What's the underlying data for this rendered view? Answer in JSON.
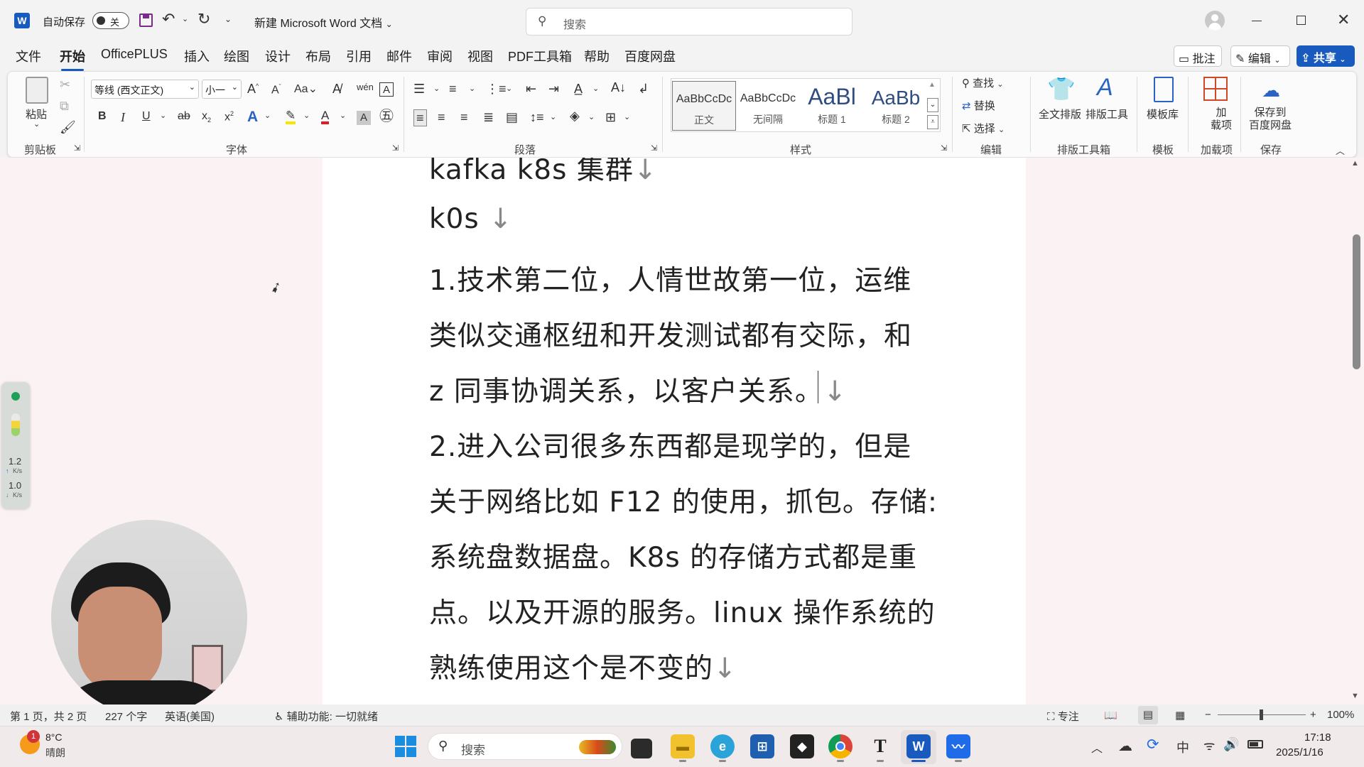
{
  "app": {
    "logo_letter": "W",
    "autosave_label": "自动保存",
    "autosave_state": "关",
    "doc_title": "新建 Microsoft Word 文档",
    "search_placeholder": "搜索"
  },
  "menu": {
    "items": [
      "文件",
      "开始",
      "OfficePLUS",
      "插入",
      "绘图",
      "设计",
      "布局",
      "引用",
      "邮件",
      "审阅",
      "视图",
      "PDF工具箱",
      "帮助",
      "百度网盘"
    ],
    "active": "开始",
    "comment_label": "批注",
    "edit_label": "编辑",
    "share_label": "共享"
  },
  "ribbon": {
    "paste_label": "粘贴",
    "font_name": "等线 (西文正文)",
    "font_size": "小一",
    "styles": [
      {
        "preview": "AaBbCcDc",
        "name": "正文",
        "active": true
      },
      {
        "preview": "AaBbCcDc",
        "name": "无间隔",
        "active": false
      },
      {
        "preview": "AaBl",
        "name": "标题 1",
        "active": false
      },
      {
        "preview": "AaBb",
        "name": "标题 2",
        "active": false
      }
    ],
    "find_label": "查找",
    "replace_label": "替换",
    "select_label": "选择",
    "fulltext_layout_label": "全文排版",
    "layout_tool_label": "排版工具",
    "template_lib_label": "模板库",
    "addin_label_1": "加",
    "addin_label_2": "载项",
    "save_baidu_1": "保存到",
    "save_baidu_2": "百度网盘",
    "groups": {
      "clipboard": "剪贴板",
      "font": "字体",
      "paragraph": "段落",
      "styles": "样式",
      "editing": "编辑",
      "layout_toolbox": "排版工具箱",
      "template": "模板",
      "addins": "加载项",
      "save": "保存"
    }
  },
  "document": {
    "lines": [
      {
        "text": "kafka k8s 集群",
        "mark": "↓"
      },
      {
        "text": "k0s   ",
        "mark": "↓"
      },
      {
        "text": "1.技术第二位，人情世故第一位，运维",
        "mark": ""
      },
      {
        "text": "类似交通枢纽和开发测试都有交际，和",
        "mark": ""
      },
      {
        "text": "z 同事协调关系，以客户关系。",
        "mark": "↓"
      },
      {
        "text": "2.进入公司很多东西都是现学的，但是",
        "mark": ""
      },
      {
        "text": "关于网络比如 F12 的使用，抓包。存储:",
        "mark": ""
      },
      {
        "text": "系统盘数据盘。K8s 的存储方式都是重",
        "mark": ""
      },
      {
        "text": "点。以及开源的服务。linux 操作系统的",
        "mark": ""
      },
      {
        "text": "熟练使用这个是不变的",
        "mark": "↓"
      }
    ]
  },
  "statusbar": {
    "page_info": "第 1 页，共 2 页",
    "word_count": "227 个字",
    "language": "英语(美国)",
    "accessibility": "辅助功能: 一切就绪",
    "focus_label": "专注",
    "zoom_minus": "−",
    "zoom_plus": "+",
    "zoom": "100%",
    "zoom_level": 0.5
  },
  "network_widget": {
    "up_value": "1.2",
    "up_unit": "K/s",
    "down_value": "1.0",
    "down_unit": "K/s"
  },
  "taskbar": {
    "weather_badge": "1",
    "temperature": "8°C",
    "weather": "晴朗",
    "search_placeholder": "搜索",
    "ime": "中",
    "time": "17:18",
    "date": "2025/1/16"
  }
}
